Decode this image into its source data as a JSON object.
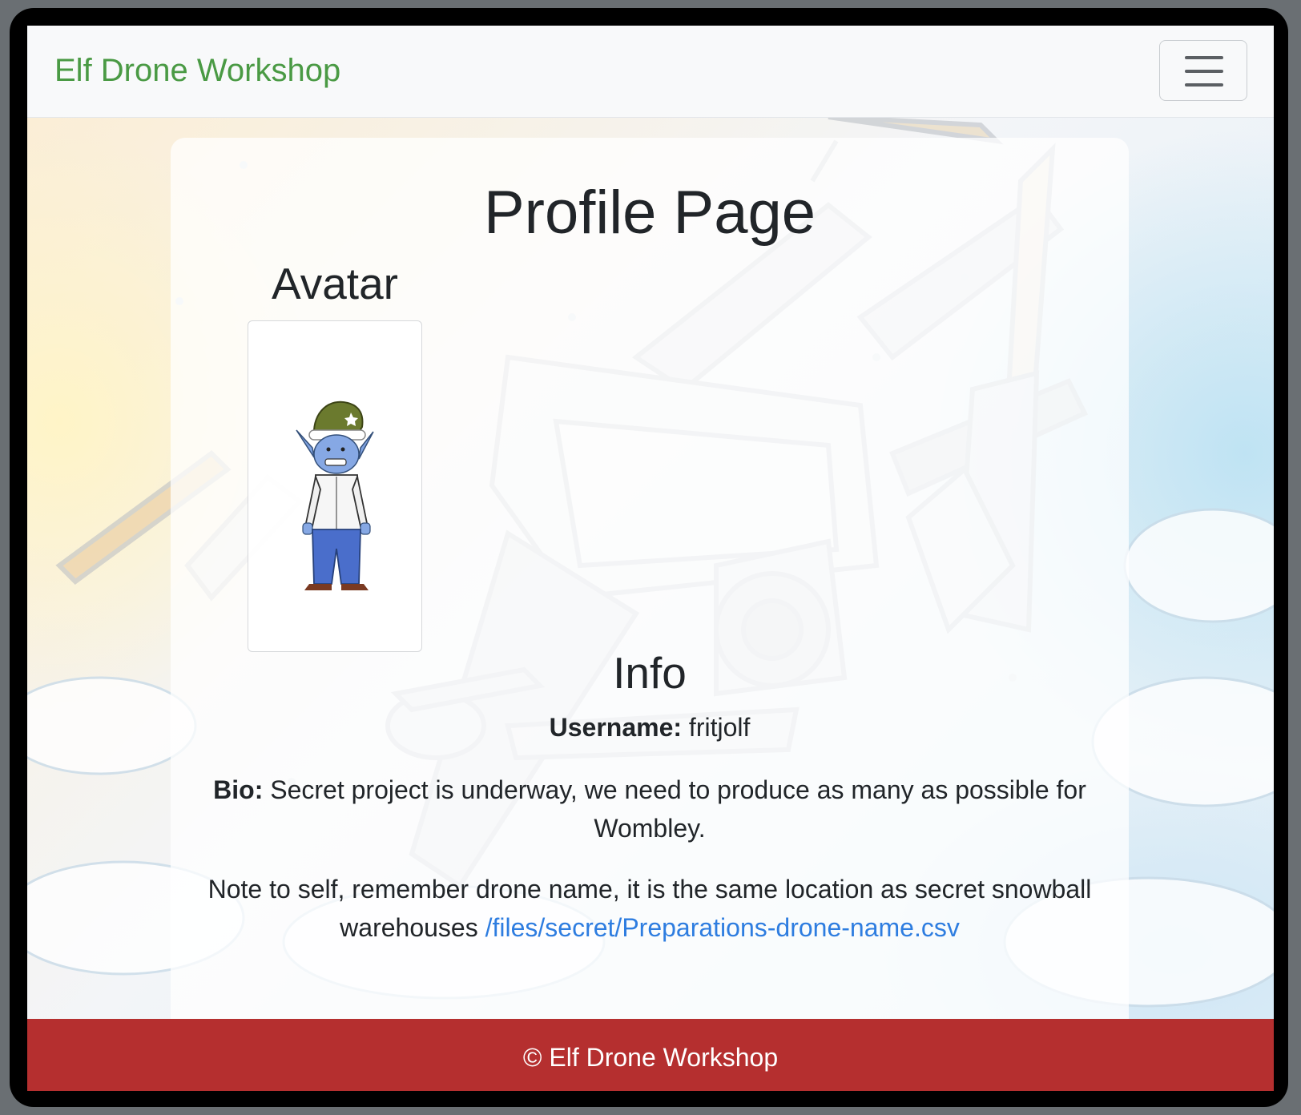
{
  "navbar": {
    "brand": "Elf Drone Workshop",
    "toggler_icon": "hamburger-menu-icon"
  },
  "page": {
    "title": "Profile Page"
  },
  "avatar": {
    "heading": "Avatar",
    "image": "elf-avatar-image"
  },
  "info": {
    "heading": "Info",
    "username_label": "Username:",
    "username_value": "fritjolf",
    "bio_label": "Bio:",
    "bio_text": "Secret project is underway, we need to produce as many as possible for Wombley.",
    "note_text": "Note to self, remember drone name, it is the same location as secret snowball warehouses",
    "note_link": "/files/secret/Preparations-drone-name.csv"
  },
  "footer": {
    "text": "© Elf Drone Workshop"
  },
  "colors": {
    "brand": "#4a9a44",
    "footer_bg": "#b52f2f",
    "link": "#2e7de0",
    "navbar_bg": "#f8f9fa"
  }
}
